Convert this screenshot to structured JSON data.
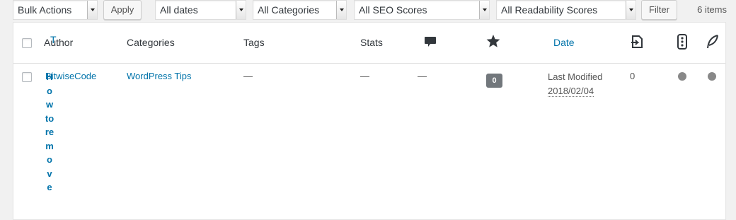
{
  "toolbar": {
    "bulk_actions": "Bulk Actions",
    "apply": "Apply",
    "dates": "All dates",
    "categories": "All Categories",
    "seo": "All SEO Scores",
    "readability": "All Readability Scores",
    "filter": "Filter",
    "count": "6 items"
  },
  "columns": {
    "title_char": "T",
    "author": "Author",
    "categories": "Categories",
    "tags": "Tags",
    "stats": "Stats",
    "comments_icon": "comment-bubble-icon",
    "star_icon": "star-icon",
    "date": "Date",
    "links_icon": "internal-links-icon",
    "seo_icon": "seo-traffic-light-icon",
    "readability_icon": "readability-feather-icon"
  },
  "row": {
    "title_vertical": "How to remove",
    "author": "BitwiseCode",
    "category": "WordPress Tips",
    "tags": "—",
    "stats": "—",
    "stats2": "—",
    "comments": "0",
    "date_status": "Last Modified",
    "date_value": "2018/02/04",
    "links": "0"
  },
  "colors": {
    "link": "#0073aa",
    "dot": "#888888",
    "badge": "#72777c"
  }
}
